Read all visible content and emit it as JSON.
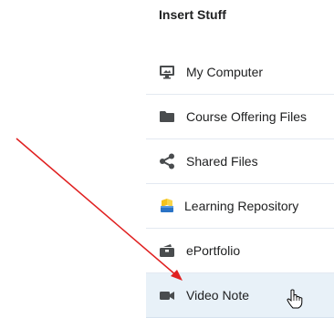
{
  "panel": {
    "title": "Insert Stuff"
  },
  "menu": {
    "items": [
      {
        "label": "My Computer",
        "icon": "monitor-icon"
      },
      {
        "label": "Course Offering Files",
        "icon": "folder-icon"
      },
      {
        "label": "Shared Files",
        "icon": "share-icon"
      },
      {
        "label": "Learning Repository",
        "icon": "repository-icon"
      },
      {
        "label": "ePortfolio",
        "icon": "eportfolio-icon"
      },
      {
        "label": "Video Note",
        "icon": "video-camera-icon",
        "state": "hovered"
      }
    ]
  },
  "colors": {
    "hover_background": "#e8f1f8",
    "icon": "#494c4e",
    "annotation_arrow": "#e02020",
    "repository_yellow": "#f5c21b",
    "repository_blue": "#2a73c6"
  }
}
